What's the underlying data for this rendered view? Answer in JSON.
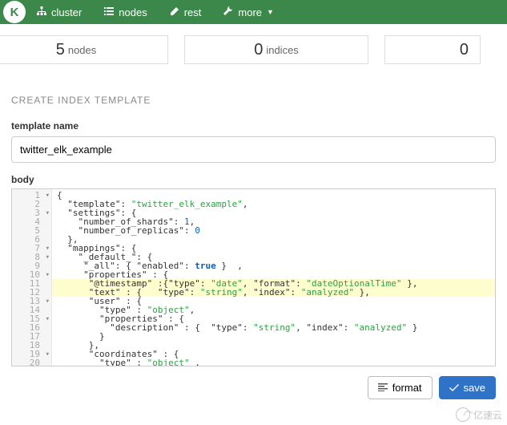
{
  "nav": {
    "items": [
      {
        "label": "cluster",
        "icon": "sitemap-icon"
      },
      {
        "label": "nodes",
        "icon": "list-icon"
      },
      {
        "label": "rest",
        "icon": "edit-icon"
      },
      {
        "label": "more",
        "icon": "wrench-icon",
        "caret": true
      }
    ]
  },
  "stats": [
    {
      "value": "5",
      "label": "nodes"
    },
    {
      "value": "0",
      "label": "indices"
    },
    {
      "value": "0",
      "label": ""
    }
  ],
  "page": {
    "title": "CREATE INDEX TEMPLATE",
    "template_name_label": "template name",
    "template_name_value": "twitter_elk_example",
    "body_label": "body"
  },
  "editor": {
    "highlighted_lines": [
      11,
      12
    ],
    "fold_lines": [
      1,
      3,
      7,
      8,
      10,
      13,
      15,
      19
    ],
    "lines": [
      {
        "n": 1,
        "tokens": [
          [
            "brace",
            "{"
          ]
        ]
      },
      {
        "n": 2,
        "tokens": [
          [
            "plain",
            "  "
          ],
          [
            "key",
            "\"template\""
          ],
          [
            "plain",
            ": "
          ],
          [
            "str",
            "\"twitter_elk_example\""
          ],
          [
            "plain",
            ","
          ]
        ]
      },
      {
        "n": 3,
        "tokens": [
          [
            "plain",
            "  "
          ],
          [
            "key",
            "\"settings\""
          ],
          [
            "plain",
            ": "
          ],
          [
            "brace",
            "{"
          ]
        ]
      },
      {
        "n": 4,
        "tokens": [
          [
            "plain",
            "    "
          ],
          [
            "key",
            "\"number_of_shards\""
          ],
          [
            "plain",
            ": "
          ],
          [
            "num",
            "1"
          ],
          [
            "plain",
            ","
          ]
        ]
      },
      {
        "n": 5,
        "tokens": [
          [
            "plain",
            "    "
          ],
          [
            "key",
            "\"number_of_replicas\""
          ],
          [
            "plain",
            ": "
          ],
          [
            "num",
            "0"
          ]
        ]
      },
      {
        "n": 6,
        "tokens": [
          [
            "plain",
            "  "
          ],
          [
            "brace",
            "}"
          ],
          [
            "plain",
            ","
          ]
        ]
      },
      {
        "n": 7,
        "tokens": [
          [
            "plain",
            "  "
          ],
          [
            "key",
            "\"mappings\""
          ],
          [
            "plain",
            ": "
          ],
          [
            "brace",
            "{"
          ]
        ]
      },
      {
        "n": 8,
        "tokens": [
          [
            "plain",
            "    "
          ],
          [
            "key",
            "\"_default_\""
          ],
          [
            "plain",
            ": "
          ],
          [
            "brace",
            "{"
          ]
        ]
      },
      {
        "n": 9,
        "tokens": [
          [
            "plain",
            "     "
          ],
          [
            "key",
            "\"_all\""
          ],
          [
            "plain",
            ": "
          ],
          [
            "brace",
            "{"
          ],
          [
            "plain",
            " "
          ],
          [
            "key",
            "\"enabled\""
          ],
          [
            "plain",
            ": "
          ],
          [
            "bool",
            "true"
          ],
          [
            "plain",
            " "
          ],
          [
            "brace",
            "}"
          ],
          [
            "plain",
            "  ,"
          ]
        ]
      },
      {
        "n": 10,
        "tokens": [
          [
            "plain",
            "     "
          ],
          [
            "key",
            "\"properties\""
          ],
          [
            "plain",
            " : "
          ],
          [
            "brace",
            "{"
          ]
        ]
      },
      {
        "n": 11,
        "tokens": [
          [
            "plain",
            "      "
          ],
          [
            "key",
            "\"@timestamp\""
          ],
          [
            "plain",
            " :"
          ],
          [
            "brace",
            "{"
          ],
          [
            "key",
            "\"type\""
          ],
          [
            "plain",
            ": "
          ],
          [
            "str",
            "\"date\""
          ],
          [
            "plain",
            ", "
          ],
          [
            "key",
            "\"format\""
          ],
          [
            "plain",
            ": "
          ],
          [
            "str",
            "\"dateOptionalTime\""
          ],
          [
            "plain",
            " "
          ],
          [
            "brace",
            "}"
          ],
          [
            "plain",
            ","
          ]
        ]
      },
      {
        "n": 12,
        "tokens": [
          [
            "plain",
            "      "
          ],
          [
            "key",
            "\"text\""
          ],
          [
            "plain",
            " : "
          ],
          [
            "brace",
            "{"
          ],
          [
            "plain",
            "   "
          ],
          [
            "key",
            "\"type\""
          ],
          [
            "plain",
            ": "
          ],
          [
            "str",
            "\"string\""
          ],
          [
            "plain",
            ", "
          ],
          [
            "key",
            "\"index\""
          ],
          [
            "plain",
            ": "
          ],
          [
            "str",
            "\"analyzed\""
          ],
          [
            "plain",
            " "
          ],
          [
            "brace",
            "}"
          ],
          [
            "plain",
            ","
          ]
        ]
      },
      {
        "n": 13,
        "tokens": [
          [
            "plain",
            "      "
          ],
          [
            "key",
            "\"user\""
          ],
          [
            "plain",
            " : "
          ],
          [
            "brace",
            "{"
          ]
        ]
      },
      {
        "n": 14,
        "tokens": [
          [
            "plain",
            "        "
          ],
          [
            "key",
            "\"type\""
          ],
          [
            "plain",
            " : "
          ],
          [
            "str",
            "\"object\""
          ],
          [
            "plain",
            ","
          ]
        ]
      },
      {
        "n": 15,
        "tokens": [
          [
            "plain",
            "        "
          ],
          [
            "key",
            "\"properties\""
          ],
          [
            "plain",
            " : "
          ],
          [
            "brace",
            "{"
          ]
        ]
      },
      {
        "n": 16,
        "tokens": [
          [
            "plain",
            "          "
          ],
          [
            "key",
            "\"description\""
          ],
          [
            "plain",
            " : "
          ],
          [
            "brace",
            "{"
          ],
          [
            "plain",
            "  "
          ],
          [
            "key",
            "\"type\""
          ],
          [
            "plain",
            ": "
          ],
          [
            "str",
            "\"string\""
          ],
          [
            "plain",
            ", "
          ],
          [
            "key",
            "\"index\""
          ],
          [
            "plain",
            ": "
          ],
          [
            "str",
            "\"analyzed\""
          ],
          [
            "plain",
            " "
          ],
          [
            "brace",
            "}"
          ]
        ]
      },
      {
        "n": 17,
        "tokens": [
          [
            "plain",
            "        "
          ],
          [
            "brace",
            "}"
          ]
        ]
      },
      {
        "n": 18,
        "tokens": [
          [
            "plain",
            "      "
          ],
          [
            "brace",
            "}"
          ],
          [
            "plain",
            ","
          ]
        ]
      },
      {
        "n": 19,
        "tokens": [
          [
            "plain",
            "      "
          ],
          [
            "key",
            "\"coordinates\""
          ],
          [
            "plain",
            " : "
          ],
          [
            "brace",
            "{"
          ]
        ]
      },
      {
        "n": 20,
        "tokens": [
          [
            "plain",
            "        "
          ],
          [
            "key",
            "\"type\""
          ],
          [
            "plain",
            " : "
          ],
          [
            "str",
            "\"object\""
          ],
          [
            "plain",
            " ,"
          ]
        ]
      }
    ]
  },
  "buttons": {
    "format": "format",
    "save": "save"
  },
  "watermark": "亿速云"
}
